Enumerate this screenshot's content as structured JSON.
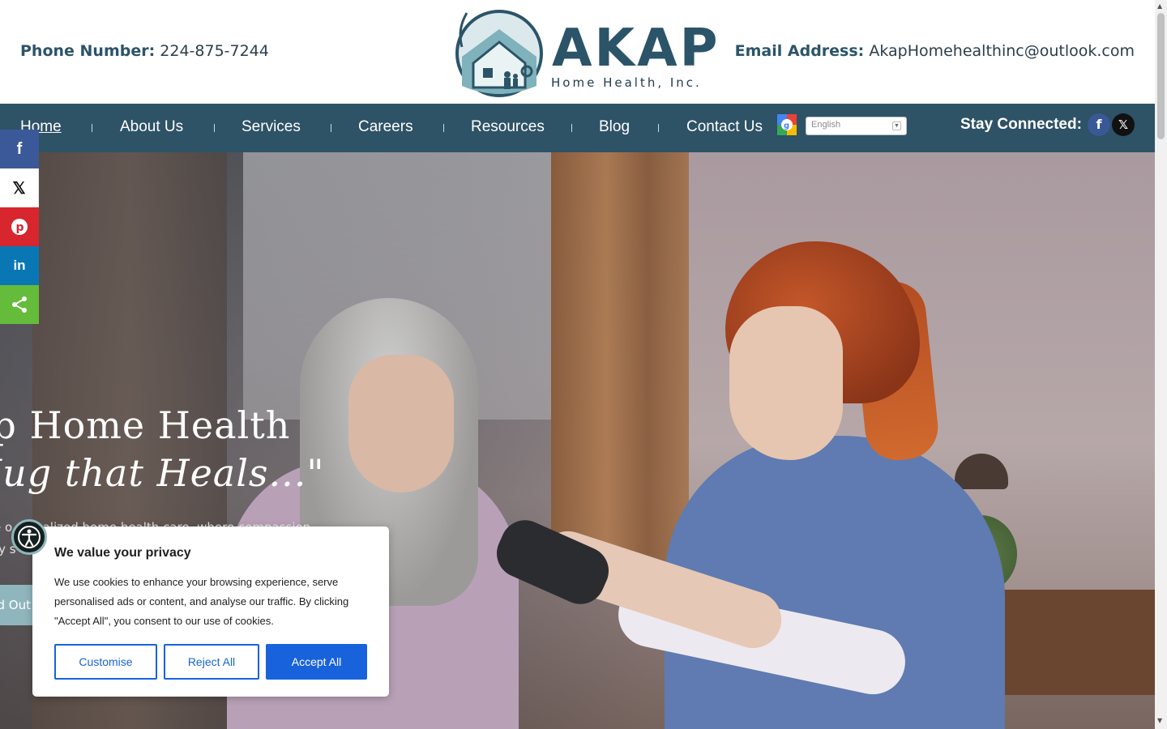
{
  "header": {
    "phone_label": "Phone Number:",
    "phone_value": "224-875-7244",
    "email_label": "Email Address:",
    "email_value": "AkapHomehealthinc@outlook.com",
    "logo_word": "AKAP",
    "logo_sub": "Home Health, Inc."
  },
  "nav": {
    "items": [
      {
        "label": "Home",
        "active": true
      },
      {
        "label": "About Us"
      },
      {
        "label": "Services"
      },
      {
        "label": "Careers"
      },
      {
        "label": "Resources"
      },
      {
        "label": "Blog"
      },
      {
        "label": "Contact Us"
      }
    ],
    "language": "English",
    "stay_connected": "Stay Connected:"
  },
  "hero": {
    "title_line1": "ap Home Health",
    "title_line2": "Hug that Heals...\"",
    "text_line1": "e o   rsonalized home health care, where compassion",
    "text_line2": "ry s",
    "button": "d Out"
  },
  "share": [
    "facebook-icon",
    "x-icon",
    "pinterest-icon",
    "linkedin-icon",
    "share-icon"
  ],
  "cookie": {
    "title": "We value your privacy",
    "body": "We use cookies to enhance your browsing experience, serve personalised ads or content, and analyse our traffic. By clicking \"Accept All\", you consent to our use of cookies.",
    "customise": "Customise",
    "reject": "Reject All",
    "accept": "Accept All"
  },
  "colors": {
    "brand": "#2e5266",
    "accent": "#8fb6bd",
    "cookie_blue": "#1863dc"
  }
}
